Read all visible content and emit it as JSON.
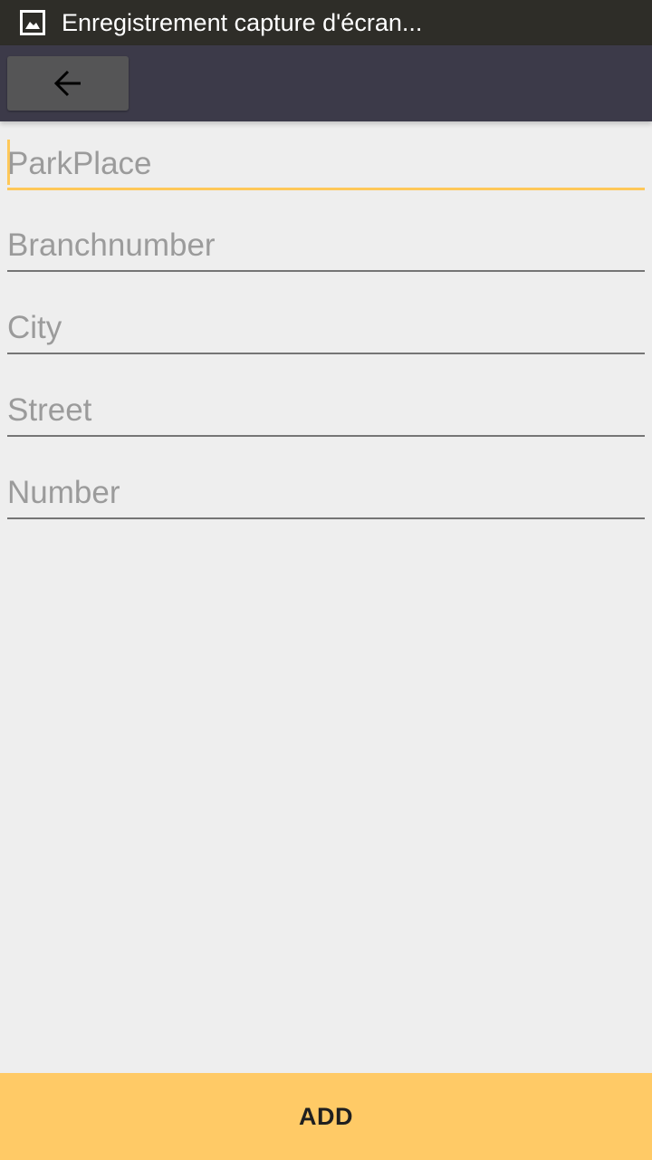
{
  "status_bar": {
    "notification_icon": "image-icon",
    "text": "Enregistrement capture d'écran..."
  },
  "toolbar": {
    "back_icon": "arrow-left-icon"
  },
  "form": {
    "fields": [
      {
        "placeholder": "ParkPlace",
        "value": "",
        "focused": true
      },
      {
        "placeholder": "Branchnumber",
        "value": ""
      },
      {
        "placeholder": "City",
        "value": ""
      },
      {
        "placeholder": "Street",
        "value": ""
      },
      {
        "placeholder": "Number",
        "value": ""
      }
    ]
  },
  "actions": {
    "add_label": "ADD"
  },
  "colors": {
    "status_bar": "#2e2d28",
    "toolbar": "#3c3a49",
    "accent": "#ffc859",
    "add_button": "#ffca66",
    "background": "#eeeeee"
  }
}
